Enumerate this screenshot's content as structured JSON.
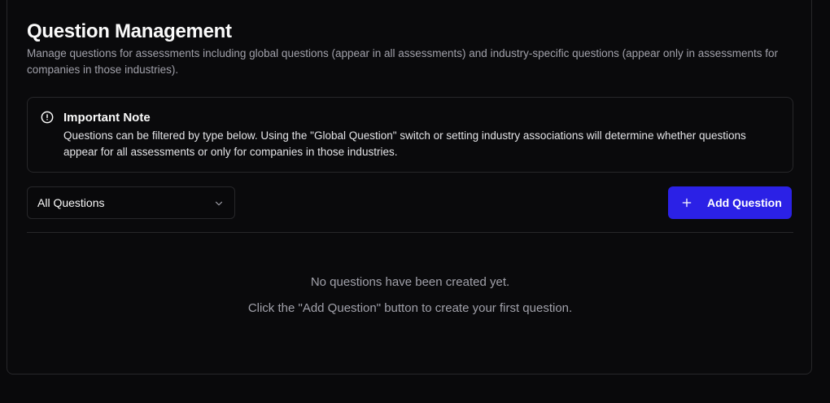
{
  "page": {
    "title": "Question Management",
    "subtitle": "Manage questions for assessments including global questions (appear in all assessments) and industry-specific questions (appear only in assessments for companies in those industries)."
  },
  "note": {
    "icon": "alert-circle-icon",
    "title": "Important Note",
    "text": "Questions can be filtered by type below. Using the \"Global Question\" switch or setting industry associations will determine whether questions appear for all assessments or only for companies in those industries."
  },
  "filter": {
    "selected": "All Questions",
    "icon": "chevron-down-icon"
  },
  "toolbar": {
    "add_label": "Add Question",
    "add_icon": "plus-icon"
  },
  "empty_state": {
    "line1": "No questions have been created yet.",
    "line2": "Click the \"Add Question\" button to create your first question."
  },
  "colors": {
    "background": "#09090b",
    "border": "#27272a",
    "accent": "#2b21e6",
    "muted_text": "#a1a1aa"
  }
}
